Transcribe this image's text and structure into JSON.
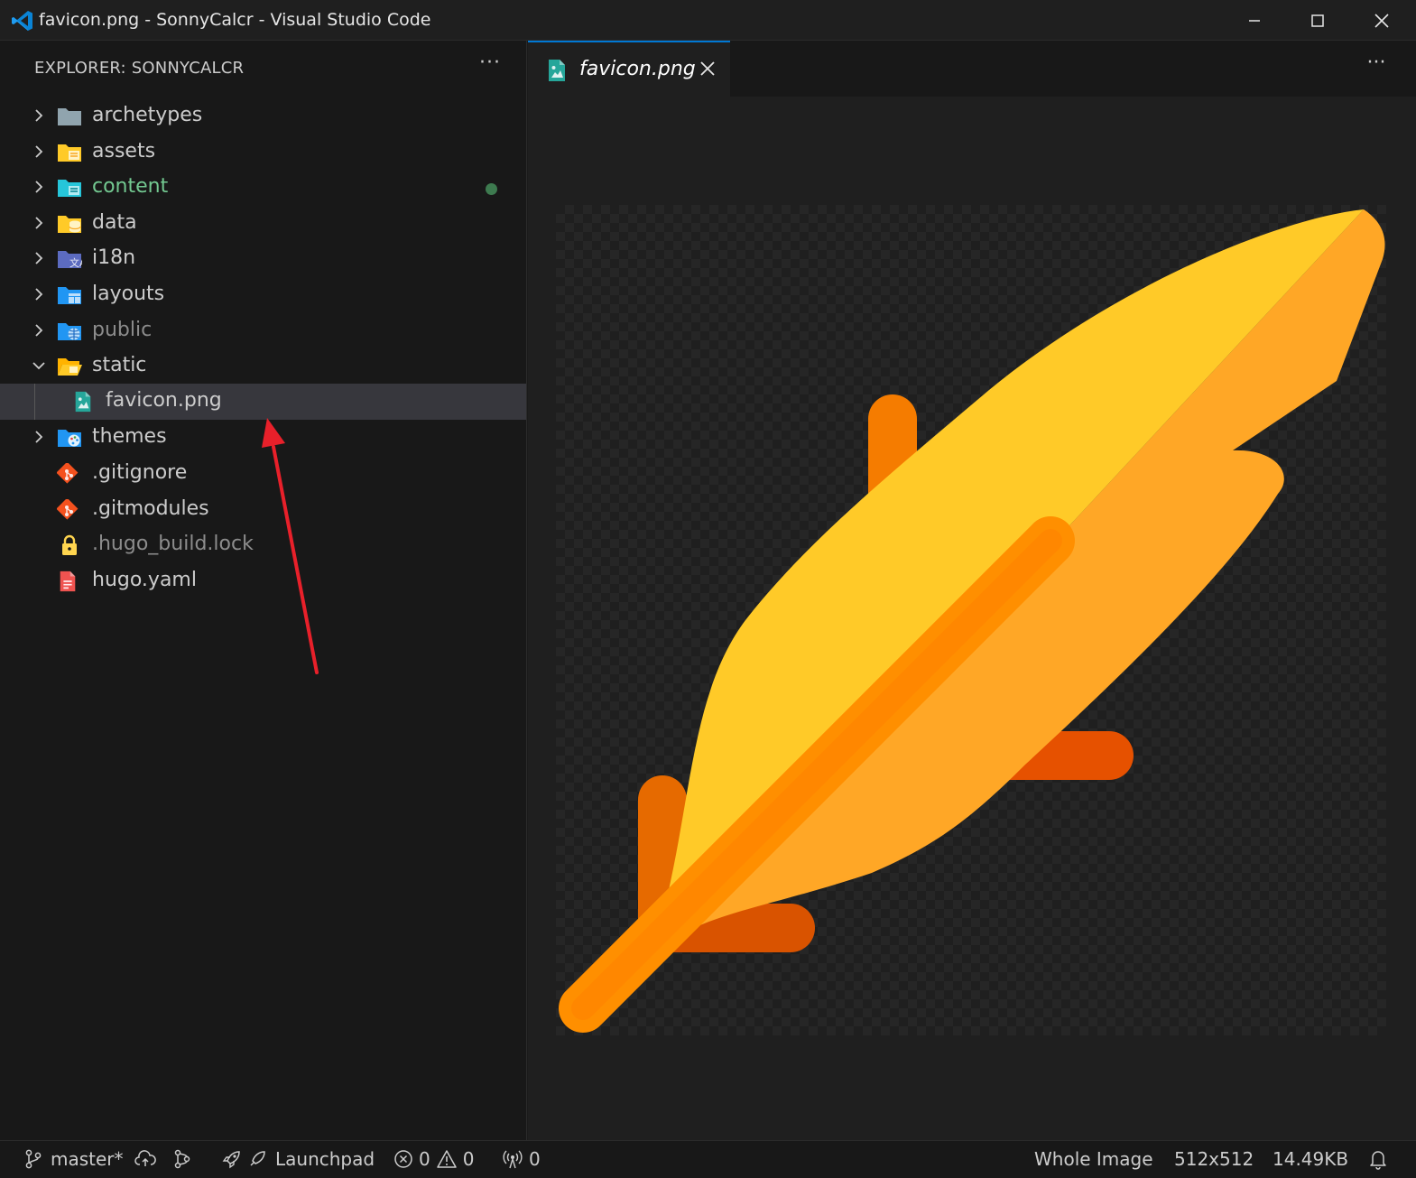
{
  "window": {
    "title": "favicon.png - SonnyCalcr - Visual Studio Code",
    "controls": [
      "minimize",
      "maximize",
      "close"
    ]
  },
  "sidebar": {
    "header": "EXPLORER: SONNYCALCR",
    "more": "···",
    "items": [
      {
        "label": "archetypes",
        "icon": "folder-gray-icon",
        "expanded": false
      },
      {
        "label": "assets",
        "icon": "folder-assets-icon",
        "expanded": false
      },
      {
        "label": "content",
        "icon": "folder-content-icon",
        "expanded": false,
        "modified": true
      },
      {
        "label": "data",
        "icon": "folder-data-icon",
        "expanded": false
      },
      {
        "label": "i18n",
        "icon": "folder-i18n-icon",
        "expanded": false
      },
      {
        "label": "layouts",
        "icon": "folder-layouts-icon",
        "expanded": false
      },
      {
        "label": "public",
        "icon": "folder-public-icon",
        "expanded": false
      },
      {
        "label": "static",
        "icon": "folder-open-icon",
        "expanded": true
      },
      {
        "label": "favicon.png",
        "icon": "image-file-icon",
        "selected": true
      },
      {
        "label": "themes",
        "icon": "folder-themes-icon",
        "expanded": false
      },
      {
        "label": ".gitignore",
        "icon": "git-icon"
      },
      {
        "label": ".gitmodules",
        "icon": "git-icon"
      },
      {
        "label": ".hugo_build.lock",
        "icon": "lock-icon"
      },
      {
        "label": "hugo.yaml",
        "icon": "yaml-file-icon"
      }
    ]
  },
  "editor": {
    "tab_label": "favicon.png",
    "more": "···"
  },
  "statusbar": {
    "branch": "master*",
    "launchpad": "Launchpad",
    "errors": "0",
    "warnings": "0",
    "ports": "0",
    "zoom": "Whole Image",
    "dimensions": "512x512",
    "filesize": "14.49KB"
  },
  "colors": {
    "accent": "#0078d4",
    "modified_green": "#73c991",
    "feather_light": "#ffca28",
    "feather_dark": "#ffa726",
    "feather_stem": "#ff8f00",
    "annotation_arrow": "#e8202a"
  }
}
